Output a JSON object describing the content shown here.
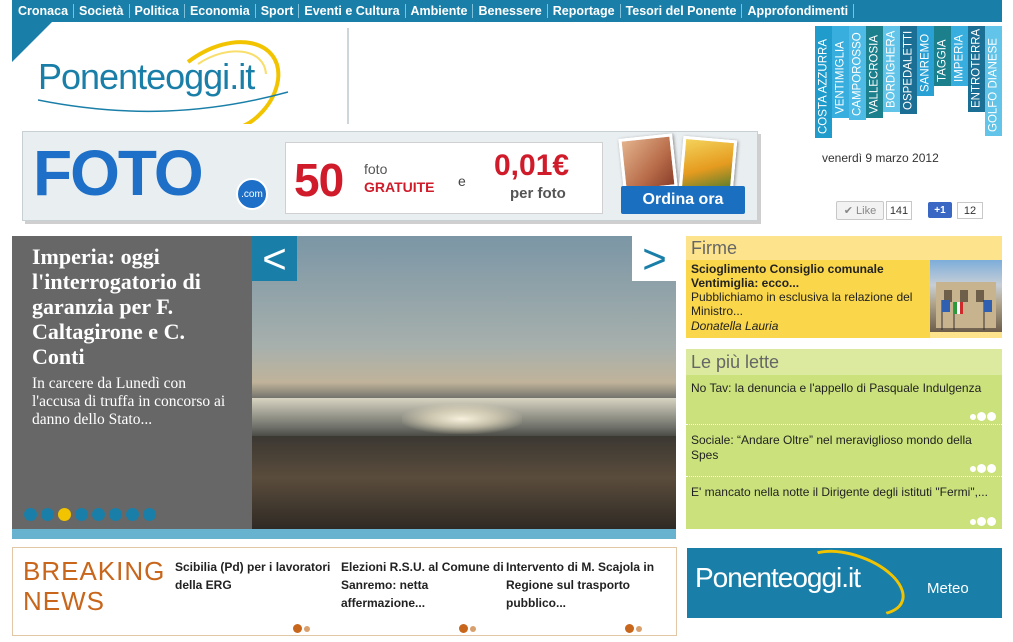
{
  "nav": {
    "items": [
      "Cronaca",
      "Società",
      "Politica",
      "Economia",
      "Sport",
      "Eventi e Cultura",
      "Ambiente",
      "Benessere",
      "Reportage",
      "Tesori del Ponente",
      "Approfondimenti"
    ]
  },
  "logo": {
    "name": "Ponenteoggi",
    "suffix": ".it"
  },
  "city_tabs": [
    {
      "label": "COSTA AZZURRA",
      "color": "#1f9ccb"
    },
    {
      "label": "VENTIMIGLIA",
      "color": "#37aede"
    },
    {
      "label": "CAMPOROSSO",
      "color": "#4dbbe6"
    },
    {
      "label": "VALLECROSIA",
      "color": "#1b7f8c"
    },
    {
      "label": "BORDIGHERA",
      "color": "#61c4e8"
    },
    {
      "label": "OSPEDALETTI",
      "color": "#1c6f94"
    },
    {
      "label": "SANREMO",
      "color": "#2aa1d4"
    },
    {
      "label": "TAGGIA",
      "color": "#1b7f8c"
    },
    {
      "label": "IMPERIA",
      "color": "#37aede"
    },
    {
      "label": "ENTROTERRA",
      "color": "#1c6f94"
    },
    {
      "label": "GOLFO DIANESE",
      "color": "#61c4e8"
    }
  ],
  "banner": {
    "brand": "FOTO",
    "brand_suffix": ".com",
    "count": "50",
    "count_label": "foto",
    "count_label2": "GRATUITE",
    "conj": "e",
    "price": "0,01€",
    "price_label": "per foto",
    "cta": "Ordina ora"
  },
  "date": "venerdì 9 marzo 2012",
  "social": {
    "like_label": "Like",
    "like_count": "141",
    "plusone_label": "+1",
    "plusone_count": "12"
  },
  "slider": {
    "title": "Imperia: oggi l'interrogatorio di garanzia per F. Caltagirone e C. Conti",
    "summary": "In carcere da Lunedì con l'accusa di truffa in concorso ai danno dello Stato...",
    "dots": 8,
    "active_dot": 2,
    "prev": "<",
    "next": ">"
  },
  "breaking": {
    "title_line1": "BREAKING",
    "title_line2": "NEWS",
    "items": [
      "Scibilia (Pd) per i lavoratori della ERG",
      "Elezioni R.S.U. al Comune di Sanremo: netta affermazione...",
      "Intervento di M. Scajola in Regione sul trasporto pubblico..."
    ]
  },
  "firme": {
    "heading": "Firme",
    "title": "Scioglimento Consiglio comunale Ventimiglia: ecco...",
    "summary": "Pubblichiamo in esclusiva la relazione del Ministro...",
    "author": "Donatella Lauria"
  },
  "piu_lette": {
    "heading": "Le più lette",
    "items": [
      "No Tav: la denuncia e l'appello di Pasquale Indulgenza",
      "Sociale: “Andare Oltre” nel meraviglioso mondo della Spes",
      "E' mancato nella notte il Dirigente degli istituti \"Fermi\",..."
    ]
  },
  "meteo": {
    "logo": "Ponenteoggi.it",
    "label": "Meteo"
  }
}
